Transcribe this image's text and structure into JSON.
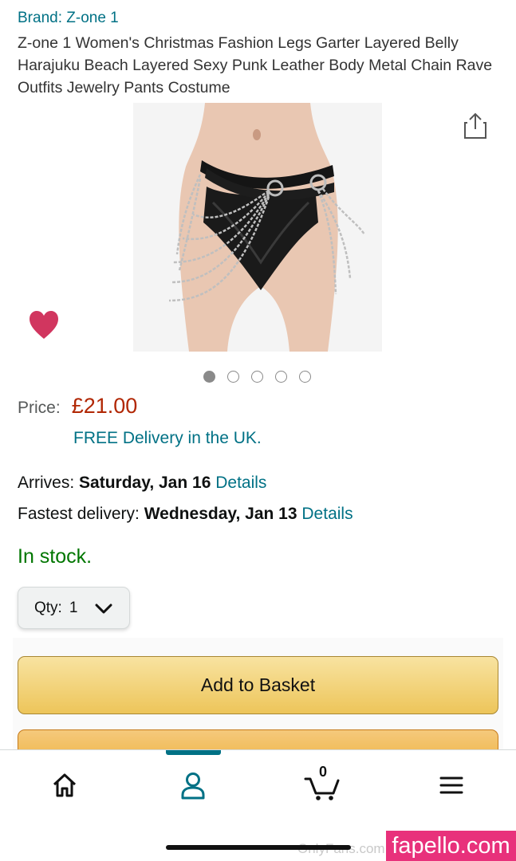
{
  "product": {
    "brand": "Brand: Z-one 1",
    "title": "Z-one 1 Women's Christmas Fashion Legs Garter Layered Belly Harajuku Beach Layered Sexy Punk Leather Body Metal Chain Rave Outfits Jewelry Pants Costume",
    "image_alt": "Product photo: leather garter belt with layered metal chains",
    "image_count": 5,
    "active_image_index": 0
  },
  "pricing": {
    "label": "Price:",
    "value": "£21.00",
    "delivery": "FREE Delivery in the UK.",
    "price_color": "#b12704"
  },
  "shipping": {
    "arrives_label": "Arrives:",
    "arrives_date": "Saturday, Jan 16",
    "fastest_label": "Fastest delivery:",
    "fastest_date": "Wednesday, Jan 13",
    "details_link": "Details"
  },
  "stock": {
    "text": "In stock.",
    "color": "#007600"
  },
  "quantity": {
    "label": "Qty:",
    "value": "1"
  },
  "actions": {
    "add_to_basket": "Add to Basket"
  },
  "nav": {
    "items": [
      "home-icon",
      "account-icon",
      "cart-icon",
      "menu-icon"
    ],
    "active": "account",
    "cart_count": "0",
    "accent": "#007185"
  },
  "watermark": {
    "source_text": "OnlyFans.com",
    "badge": "fapello.com"
  },
  "colors": {
    "link": "#007185",
    "button_yellow": "#f0c14b",
    "heart": "#d1365f"
  }
}
